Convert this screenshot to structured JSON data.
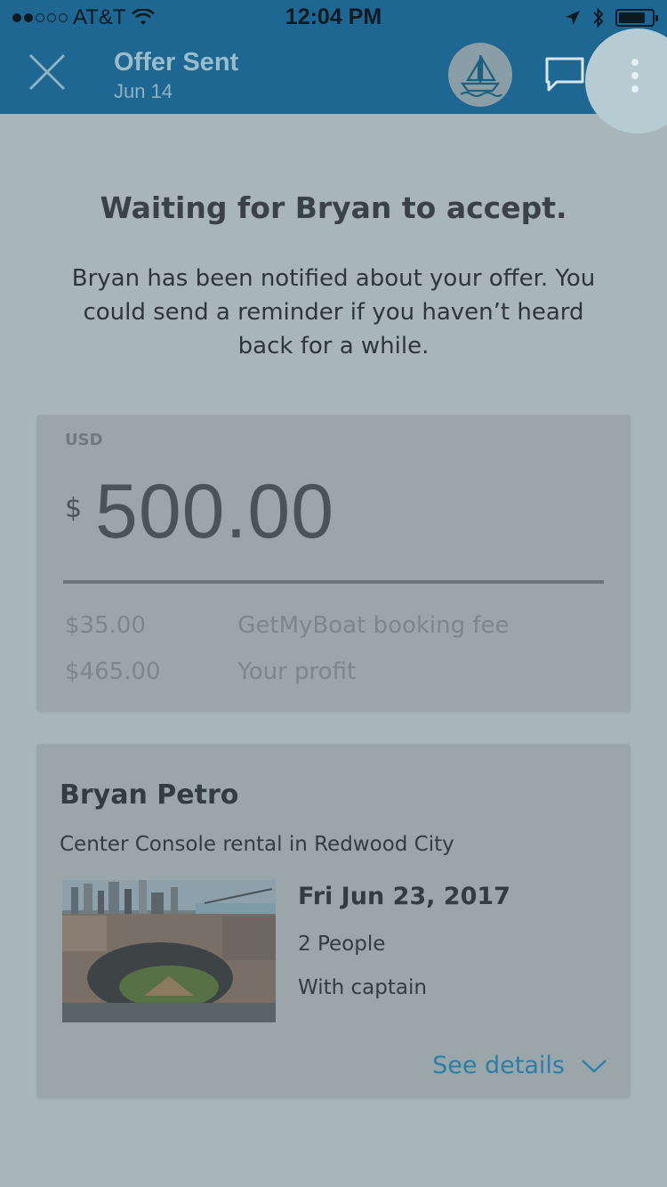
{
  "status_bar": {
    "carrier": "AT&T",
    "time": "12:04 PM"
  },
  "nav": {
    "title": "Offer Sent",
    "subtitle": "Jun 14"
  },
  "message": {
    "headline": "Waiting for Bryan to accept.",
    "body": "Bryan has been notified about your offer. You could send a reminder if you haven’t heard back for a while."
  },
  "offer": {
    "currency": "USD",
    "symbol": "$",
    "amount": "500.00",
    "fee_value": "$35.00",
    "fee_label": "GetMyBoat booking fee",
    "profit_value": "$465.00",
    "profit_label": "Your profit"
  },
  "trip": {
    "guest_name": "Bryan Petro",
    "rental": "Center Console rental in Redwood City",
    "date": "Fri Jun 23, 2017",
    "people": "2 People",
    "captain": "With captain",
    "see_details": "See details"
  },
  "colors": {
    "nav_bg": "#1d6792",
    "page_bg": "#a8b5b9",
    "card_bg": "#9aa6aa",
    "link": "#2b7fa7"
  },
  "icons": [
    "close-icon",
    "boat-icon",
    "chat-icon",
    "more-vertical-icon",
    "chevron-down-icon",
    "wifi-icon",
    "location-arrow-icon",
    "bluetooth-icon",
    "battery-icon"
  ]
}
